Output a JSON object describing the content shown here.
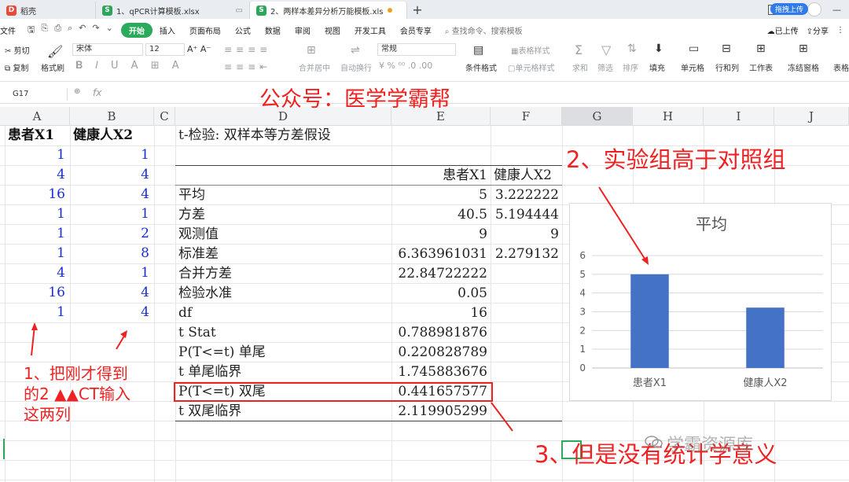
{
  "tabs": [
    {
      "label": "稻壳",
      "icon": "docer-logo-icon",
      "color": "#e54a3b"
    },
    {
      "label": "1、qPCR计算模板.xlsx",
      "icon": "spreadsheet-icon",
      "color": "#2ca65b"
    },
    {
      "label": "2、两样本差异分析万能模板.xls",
      "icon": "spreadsheet-icon",
      "color": "#2ca65b",
      "active": true
    }
  ],
  "window": {
    "page_count": "2"
  },
  "menu": {
    "file": "文件",
    "start": "开始",
    "items": [
      "插入",
      "页面布局",
      "公式",
      "数据",
      "审阅",
      "视图",
      "开发工具",
      "会员专享"
    ],
    "search_placeholder": "查找命令、搜索模板",
    "cloud": "已上传",
    "upload": "拖拽上传",
    "share": "分享"
  },
  "ribbon": {
    "cut": "剪切",
    "copy": "复制",
    "format_painter": "格式刷",
    "font_name": "宋体",
    "font_size": "12",
    "merge_center": "合并居中",
    "wrap": "自动换行",
    "number_format": "常规",
    "conditional_format": "条件格式",
    "table_style": "表格样式",
    "cell_style": "单元格样式",
    "sum": "求和",
    "filter": "筛选",
    "sort": "排序",
    "fill": "填充",
    "cells": "单元格",
    "row_col": "行和列",
    "worksheet": "工作表",
    "freeze": "冻结窗格",
    "table_tools": "表格"
  },
  "formula_bar": {
    "name_box": "G17",
    "fx": "fx",
    "formula": ""
  },
  "columns": [
    "A",
    "B",
    "C",
    "D",
    "E",
    "F",
    "G",
    "H",
    "I",
    "J"
  ],
  "selected_column": "G",
  "col_a_header": "患者X1",
  "col_b_header": "健康人X2",
  "col_a_values": [
    "1",
    "4",
    "16",
    "1",
    "1",
    "1",
    "4",
    "16",
    "1"
  ],
  "col_b_values": [
    "1",
    "4",
    "4",
    "1",
    "2",
    "8",
    "1",
    "4",
    "4"
  ],
  "ttest": {
    "title": "t-检验: 双样本等方差假设",
    "col_headers": [
      "患者X1",
      "健康人X2"
    ],
    "rows": [
      {
        "label": "平均",
        "x1": "5",
        "x2": "3.222222"
      },
      {
        "label": "方差",
        "x1": "40.5",
        "x2": "5.194444"
      },
      {
        "label": "观测值",
        "x1": "9",
        "x2": "9"
      },
      {
        "label": "标准差",
        "x1": "6.363961031",
        "x2": "2.279132"
      },
      {
        "label": "合并方差",
        "x1": "22.84722222",
        "x2": ""
      },
      {
        "label": "检验水准",
        "x1": "0.05",
        "x2": ""
      },
      {
        "label": "df",
        "x1": "16",
        "x2": ""
      },
      {
        "label": "t Stat",
        "x1": "0.788981876",
        "x2": ""
      },
      {
        "label": "P(T<=t) 单尾",
        "x1": "0.220828789",
        "x2": ""
      },
      {
        "label": "t 单尾临界",
        "x1": "1.745883676",
        "x2": ""
      },
      {
        "label": "P(T<=t) 双尾",
        "x1": "0.441657577",
        "x2": ""
      },
      {
        "label": "t 双尾临界",
        "x1": "2.119905299",
        "x2": ""
      }
    ]
  },
  "chart_data": {
    "type": "bar",
    "title": "平均",
    "categories": [
      "患者X1",
      "健康人X2"
    ],
    "values": [
      5,
      3.222222
    ],
    "ylim": [
      0,
      6
    ],
    "yticks": [
      "0",
      "1",
      "2",
      "3",
      "4",
      "5",
      "6"
    ],
    "grid": true,
    "bar_color": "#4472c4"
  },
  "annotations": {
    "header": "公众号：医学学霸帮",
    "note1_line1": "1、把刚才得到",
    "note1_line2": "的2 ▲▲CT输入",
    "note1_line3": "这两列",
    "note2": "2、实验组高于对照组",
    "note3": "3、但是没有统计学意义",
    "watermark": "学霸资源库",
    "color": "#ee2222"
  }
}
